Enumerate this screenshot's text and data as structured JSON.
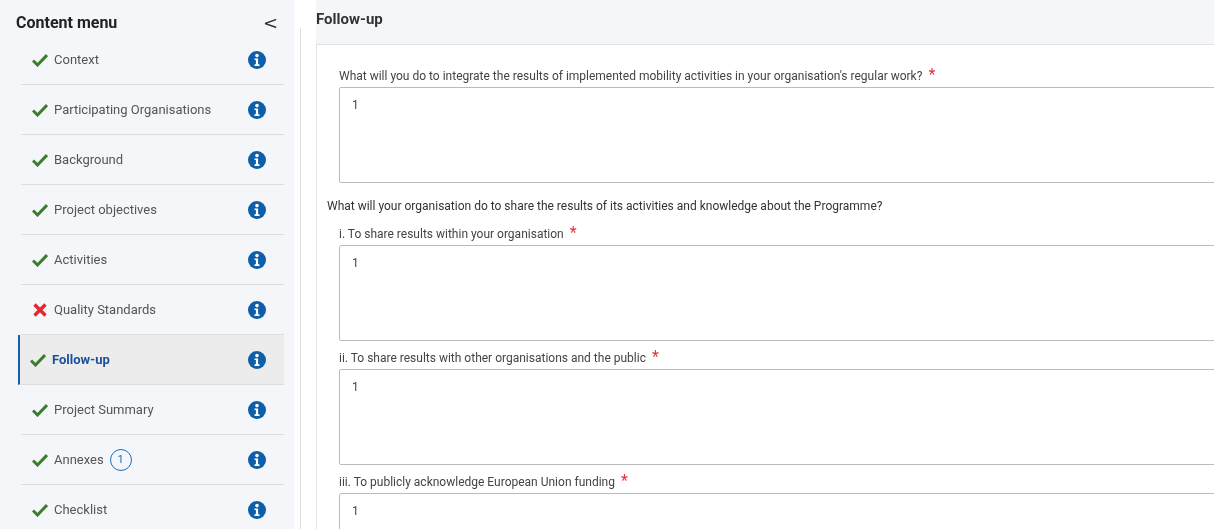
{
  "sidebar": {
    "title": "Content menu",
    "collapse": "<",
    "items": [
      {
        "label": "Context",
        "complete": true,
        "selected": false
      },
      {
        "label": "Participating Organisations",
        "complete": true,
        "selected": false
      },
      {
        "label": "Background",
        "complete": true,
        "selected": false
      },
      {
        "label": "Project objectives",
        "complete": true,
        "selected": false
      },
      {
        "label": "Activities",
        "complete": true,
        "selected": false
      },
      {
        "label": "Quality Standards",
        "complete": false,
        "selected": false
      },
      {
        "label": "Follow-up",
        "complete": true,
        "selected": true
      },
      {
        "label": "Project Summary",
        "complete": true,
        "selected": false
      },
      {
        "label": "Annexes",
        "complete": true,
        "selected": false,
        "badge": "1"
      },
      {
        "label": "Checklist",
        "complete": true,
        "selected": false
      }
    ]
  },
  "main": {
    "title": "Follow-up",
    "blocks": [
      {
        "kind": "field",
        "label": "What will you do to integrate the results of implemented mobility activities in your organisation's regular work?",
        "required_mark": "*",
        "value": "1"
      },
      {
        "kind": "heading",
        "label": "What will your organisation do to share the results of its activities and knowledge about the Programme?"
      },
      {
        "kind": "field",
        "label": "i. To share results within your organisation",
        "required_mark": "*",
        "value": "1"
      },
      {
        "kind": "field",
        "label": "ii. To share results with other organisations and the public",
        "required_mark": "*",
        "value": "1"
      },
      {
        "kind": "field",
        "label": "iii. To publicly acknowledge European Union funding",
        "required_mark": "*",
        "value": "1"
      }
    ]
  }
}
